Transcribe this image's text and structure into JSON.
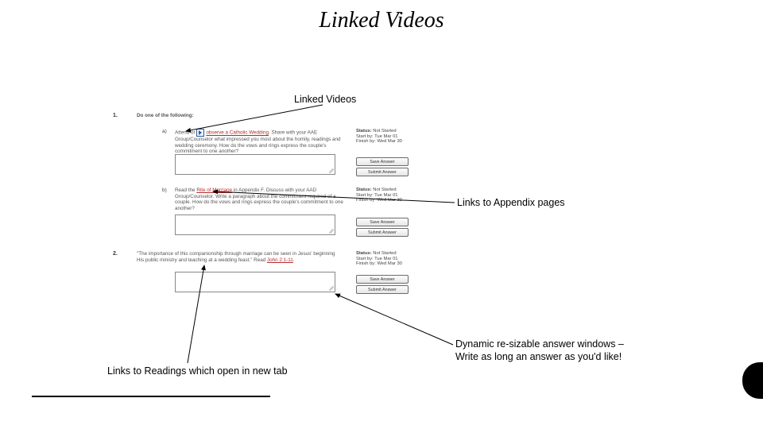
{
  "slide": {
    "title": "Linked Videos"
  },
  "callouts": {
    "top": "Linked Videos",
    "right": "Links to Appendix pages",
    "bottom_left": "Links to Readings which open in new tab",
    "bottom_right_l1": "Dynamic re-sizable answer windows –",
    "bottom_right_l2": "Write as long an answer as you'd like!"
  },
  "questions": {
    "q1": {
      "num": "1.",
      "prompt": "Do one of the following:",
      "a": {
        "label": "a)",
        "text_before": "Attend or ",
        "link_text": "observe a Catholic Wedding",
        "text_after": ". Share with your AAE Group/Counselor what impressed you most about the homily, readings and wedding ceremony. How do the vows and rings express the couple's commitment to one another?"
      },
      "b": {
        "label": "b)",
        "text_before": "Read the ",
        "link_text": "Rite of Marriage",
        "text_after": " in Appendix F. Discuss with your AAD Group/Counselor. Write a paragraph about the commitment required of a couple. How do the vows and rings express the couple's commitment to one another?"
      }
    },
    "q2": {
      "num": "2.",
      "text_before": "\"The importance of this companionship through marriage can be seen in Jesus' beginning His public ministry and teaching at a wedding feast.\" Read ",
      "link_text": "John 2:1-11",
      "text_after": "."
    }
  },
  "status": {
    "title_label": "Status:",
    "title_value": "Not Started",
    "start_label": "Start by:",
    "start_value": "Tue Mar 01",
    "finish_label": "Finish by:",
    "finish_value": "Wed Mar 30"
  },
  "buttons": {
    "save": "Save Answer",
    "submit": "Submit Answer"
  }
}
